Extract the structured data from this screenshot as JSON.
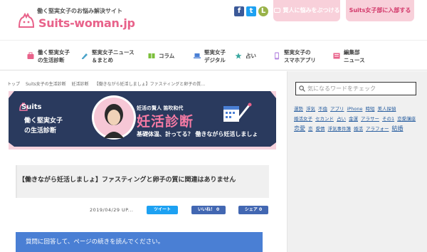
{
  "header": {
    "tagline": "働く堅実女子のお悩み解決サイト",
    "logo_text": "Suits-woman.jp",
    "social": {
      "facebook": "f",
      "twitter": "t",
      "line": "L"
    },
    "consult_label": "賢人に悩みをぶつける",
    "join_label": "Suits女子部に入部する"
  },
  "nav": {
    "items": [
      {
        "icon": "briefcase-icon",
        "line1": "働く堅実女子",
        "line2": "の生活診断"
      },
      {
        "icon": "pencil-icon",
        "line1": "堅実女子ニュース",
        "line2": "＆まとめ"
      },
      {
        "icon": "book-icon",
        "line1": "コラム",
        "line2": ""
      },
      {
        "icon": "laptop-icon",
        "line1": "堅実女子",
        "line2": "デジタル"
      },
      {
        "icon": "star-icon",
        "line1": "占い",
        "line2": ""
      },
      {
        "icon": "smartphone-icon",
        "line1": "堅実女子の",
        "line2": "スマホアプリ"
      },
      {
        "icon": "newspaper-icon",
        "line1": "編集部",
        "line2": "ニュース"
      }
    ]
  },
  "breadcrumb": [
    "トップ",
    "Suits女子の生活診断",
    "妊活診断",
    "【働きながら妊活しましょ】ファスティングと卵子の質…"
  ],
  "banner": {
    "brand": "Suits",
    "sub1": "働く堅実女子",
    "sub2": "の生活診断",
    "author": "妊活の賢人 笛吹和代",
    "title": "妊活診断",
    "catch": "基礎体温、計ってる？ 働きながら妊活しましょ"
  },
  "article": {
    "title": "【働きながら妊活しましょ】ファスティングと卵子の質に関連はありません",
    "date": "2019/04/29 UP...",
    "tweet_label": "ツイート",
    "like_label": "いいね！ 0",
    "share_label": "シェア 0",
    "cta": "質問に回答して、ページの続きを読んでください。"
  },
  "sidebar": {
    "search_placeholder": "気になるワードをチェック",
    "tags": [
      {
        "t": "運勢",
        "big": false
      },
      {
        "t": "浮気",
        "big": false
      },
      {
        "t": "不倫",
        "big": false
      },
      {
        "t": "アプリ",
        "big": false
      },
      {
        "t": "iPhone",
        "big": false
      },
      {
        "t": "時短",
        "big": false
      },
      {
        "t": "美人探偵",
        "big": false
      },
      {
        "t": "婚活女子",
        "big": false
      },
      {
        "t": "セカンド",
        "big": false
      },
      {
        "t": "占い",
        "big": false
      },
      {
        "t": "金運",
        "big": false
      },
      {
        "t": "アラサー",
        "big": false
      },
      {
        "t": "その1",
        "big": false
      },
      {
        "t": "恋愛講座",
        "big": false
      },
      {
        "t": "恋愛",
        "big": true
      },
      {
        "t": "恋",
        "big": false
      },
      {
        "t": "愛情",
        "big": false
      },
      {
        "t": "浮気事件簿",
        "big": false
      },
      {
        "t": "婚活",
        "big": false
      },
      {
        "t": "アラフォー",
        "big": false
      },
      {
        "t": "結婚",
        "big": true
      }
    ]
  },
  "colors": {
    "brand_pink": "#e8628a",
    "banner_navy": "#2a3a5e",
    "cta_blue": "#4a7fd4"
  }
}
